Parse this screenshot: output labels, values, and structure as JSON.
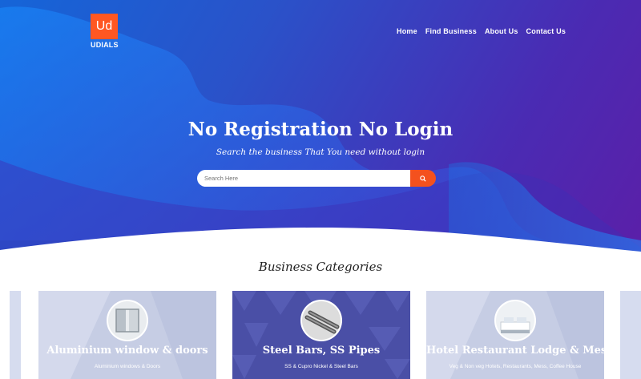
{
  "logo": {
    "mark": "Ud",
    "name": "UDIALS"
  },
  "nav": {
    "items": [
      "Home",
      "Find Business",
      "About Us",
      "Contact Us"
    ]
  },
  "hero": {
    "headline": "No Registration No Login",
    "subline": "Search the business That You need without login"
  },
  "search": {
    "placeholder": "Search Here",
    "button_icon": "search-icon"
  },
  "categories": {
    "title": "Business Categories",
    "cards": [
      {
        "title": "Aluminium window & doors",
        "subtitle": "Aluminium windows & Doors",
        "icon": "window-icon"
      },
      {
        "title": "Steel Bars, SS Pipes",
        "subtitle": "SS & Cupro Nickel & Steel Bars",
        "icon": "pipes-icon"
      },
      {
        "title": "Hotel Restaurant Lodge & Mess",
        "subtitle": "Veg & Non veg Hotels, Restaurants, Mess, Coffee House",
        "icon": "bedroom-icon"
      }
    ]
  },
  "colors": {
    "accent": "#f4511e",
    "logo_bg": "#ff5722",
    "hero_start": "#1565d8",
    "hero_end": "#5b1fa8"
  }
}
